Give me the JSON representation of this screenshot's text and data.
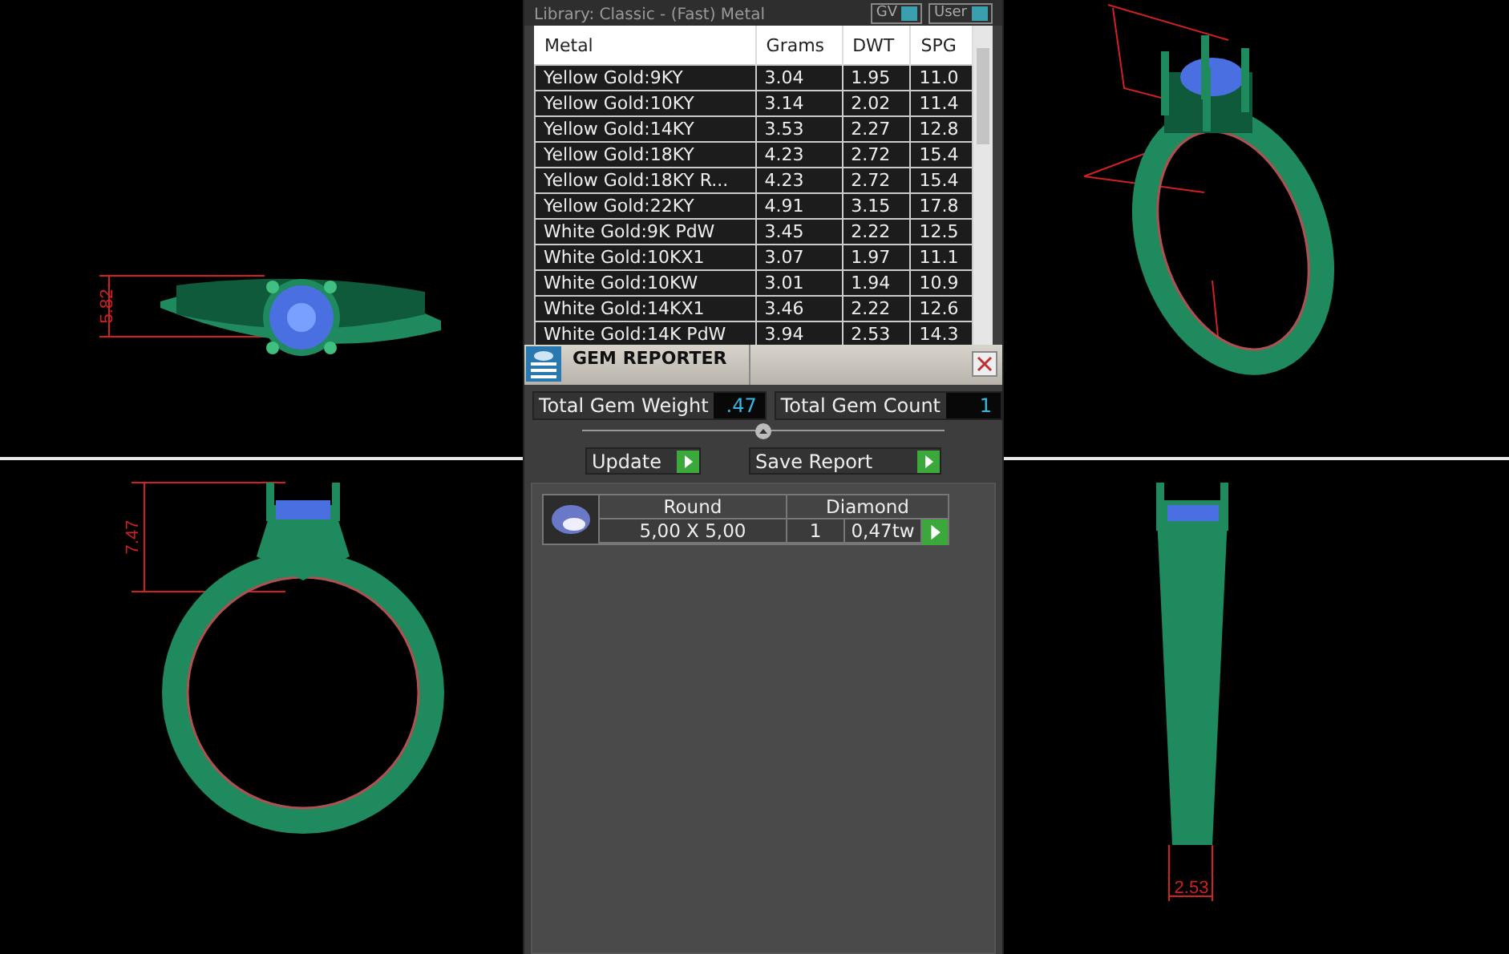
{
  "views": [
    {
      "kind": "top",
      "dimension": "5.82"
    },
    {
      "kind": "iso"
    },
    {
      "kind": "front",
      "dimension": "7.47"
    },
    {
      "kind": "side",
      "dimension": "2.53"
    }
  ],
  "panel": {
    "library_label": "Library: Classic - (Fast) Metal",
    "toggles": [
      {
        "label": "GV"
      },
      {
        "label": "User"
      }
    ],
    "metal_table": {
      "columns": [
        "Metal",
        "Grams",
        "DWT",
        "SPG"
      ],
      "rows": [
        [
          "Yellow Gold:9KY",
          "3.04",
          "1.95",
          "11.0"
        ],
        [
          "Yellow Gold:10KY",
          "3.14",
          "2.02",
          "11.4"
        ],
        [
          "Yellow Gold:14KY",
          "3.53",
          "2.27",
          "12.8"
        ],
        [
          "Yellow Gold:18KY",
          "4.23",
          "2.72",
          "15.4"
        ],
        [
          "Yellow Gold:18KY R...",
          "4.23",
          "2.72",
          "15.4"
        ],
        [
          "Yellow Gold:22KY",
          "4.91",
          "3.15",
          "17.8"
        ],
        [
          "White Gold:9K PdW",
          "3.45",
          "2.22",
          "12.5"
        ],
        [
          "White Gold:10KX1",
          "3.07",
          "1.97",
          "11.1"
        ],
        [
          "White Gold:10KW",
          "3.01",
          "1.94",
          "10.9"
        ],
        [
          "White Gold:14KX1",
          "3.46",
          "2.22",
          "12.6"
        ],
        [
          "White Gold:14K PdW",
          "3.94",
          "2.53",
          "14.3"
        ]
      ]
    },
    "gem_reporter": {
      "title": "GEM REPORTER",
      "totals": [
        {
          "label": "Total Gem Weight",
          "value": ".47"
        },
        {
          "label": "Total Gem Count",
          "value": "1"
        }
      ],
      "buttons": [
        "Update",
        "Save Report"
      ],
      "gems": [
        {
          "shape": "Round",
          "size": "5,00 X 5,00",
          "material": "Diamond",
          "count": "1",
          "weight": "0,47tw"
        }
      ]
    }
  }
}
